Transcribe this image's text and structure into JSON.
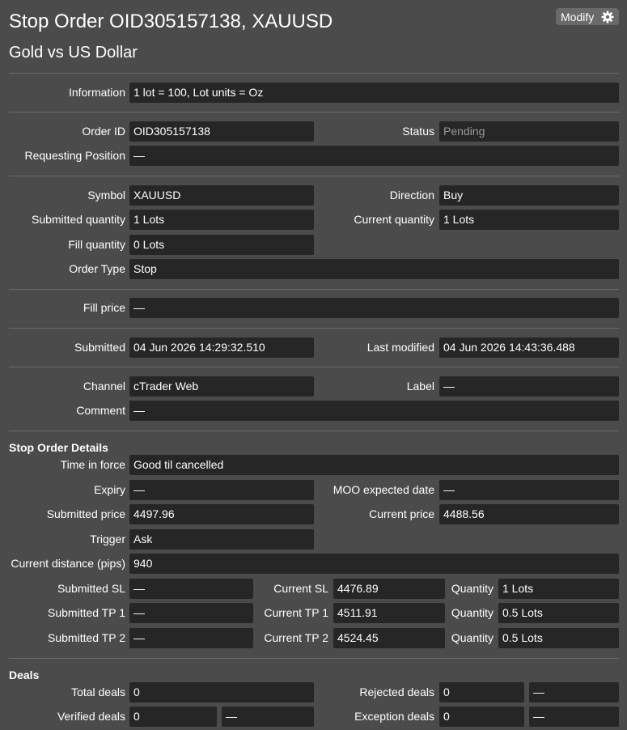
{
  "header": {
    "title": "Stop Order OID305157138, XAUUSD",
    "subtitle": "Gold vs US Dollar",
    "modify_label": "Modify",
    "modify_icon": "gear-icon"
  },
  "info": {
    "information_label": "Information",
    "information_value": "1 lot = 100, Lot units = Oz"
  },
  "ids": {
    "order_id_label": "Order ID",
    "order_id_value": "OID305157138",
    "status_label": "Status",
    "status_value": "Pending",
    "requesting_position_label": "Requesting Position",
    "requesting_position_value": "—"
  },
  "order": {
    "symbol_label": "Symbol",
    "symbol_value": "XAUUSD",
    "direction_label": "Direction",
    "direction_value": "Buy",
    "submitted_qty_label": "Submitted quantity",
    "submitted_qty_value": "1 Lots",
    "current_qty_label": "Current quantity",
    "current_qty_value": "1 Lots",
    "fill_qty_label": "Fill quantity",
    "fill_qty_value": "0 Lots",
    "order_type_label": "Order Type",
    "order_type_value": "Stop"
  },
  "fill": {
    "fill_price_label": "Fill price",
    "fill_price_value": "—"
  },
  "times": {
    "submitted_label": "Submitted",
    "submitted_value": "04 Jun 2026 14:29:32.510",
    "last_modified_label": "Last modified",
    "last_modified_value": "04 Jun 2026 14:43:36.488"
  },
  "meta": {
    "channel_label": "Channel",
    "channel_value": "cTrader Web",
    "label_label": "Label",
    "label_value": "—",
    "comment_label": "Comment",
    "comment_value": "—"
  },
  "details": {
    "heading": "Stop Order Details",
    "tif_label": "Time in force",
    "tif_value": "Good til cancelled",
    "expiry_label": "Expiry",
    "expiry_value": "—",
    "moo_label": "MOO expected date",
    "moo_value": "—",
    "submitted_price_label": "Submitted price",
    "submitted_price_value": "4497.96",
    "current_price_label": "Current price",
    "current_price_value": "4488.56",
    "trigger_label": "Trigger",
    "trigger_value": "Ask",
    "distance_label": "Current distance (pips)",
    "distance_value": "940",
    "sl": {
      "submitted_label": "Submitted SL",
      "submitted_value": "—",
      "current_label": "Current SL",
      "current_value": "4476.89",
      "qty_label": "Quantity",
      "qty_value": "1 Lots"
    },
    "tp1": {
      "submitted_label": "Submitted TP 1",
      "submitted_value": "—",
      "current_label": "Current TP 1",
      "current_value": "4511.91",
      "qty_label": "Quantity",
      "qty_value": "0.5 Lots"
    },
    "tp2": {
      "submitted_label": "Submitted TP 2",
      "submitted_value": "—",
      "current_label": "Current TP 2",
      "current_value": "4524.45",
      "qty_label": "Quantity",
      "qty_value": "0.5 Lots"
    }
  },
  "deals": {
    "heading": "Deals",
    "total_label": "Total deals",
    "total_value": "0",
    "rejected_label": "Rejected deals",
    "rejected_value": "0",
    "rejected_extra": "—",
    "verified_label": "Verified deals",
    "verified_value": "0",
    "verified_extra": "—",
    "exception_label": "Exception deals",
    "exception_value": "0",
    "exception_extra": "—"
  }
}
